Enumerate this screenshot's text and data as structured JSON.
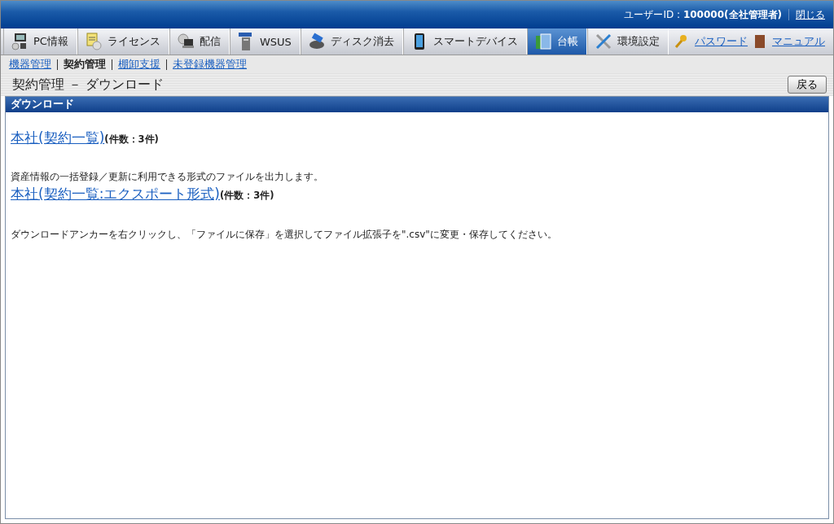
{
  "header": {
    "user": "ユーザーID : **100000(全社管理者)**",
    "close": "閉じる"
  },
  "tabs": [
    {
      "label": "PC情報",
      "selected": false
    },
    {
      "label": "ライセンス",
      "selected": false
    },
    {
      "label": "配信",
      "selected": false
    },
    {
      "label": "WSUS",
      "selected": false
    },
    {
      "label": "ディスク消去",
      "selected": false
    },
    {
      "label": "スマートデバイス",
      "selected": false
    },
    {
      "label": "台帳",
      "selected": true
    },
    {
      "label": "環境設定",
      "selected": false
    }
  ],
  "tools": [
    {
      "label": "パスワード"
    },
    {
      "label": "マニュアル"
    }
  ],
  "subnav": [
    {
      "label": "機器管理",
      "selected": false
    },
    {
      "label": "契約管理",
      "selected": true
    },
    {
      "label": "棚卸支援",
      "selected": false
    },
    {
      "label": "未登録機器管理",
      "selected": false
    }
  ],
  "page_title": "契約管理 － ダウンロード",
  "back_button": "戻る",
  "section": {
    "title": "ダウンロード",
    "items": [
      {
        "link": "本社(契約一覧)",
        "count": "(件数：3件)"
      },
      {
        "description": "資産情報の一括登録／更新に利用できる形式のファイルを出力します。",
        "link": "本社(契約一覧:エクスポート形式)",
        "count": "(件数：3件)"
      }
    ],
    "note": "ダウンロードアンカーを右クリックし、「ファイルに保存」を選択してファイル拡張子を\".csv\"に変更・保存してください。"
  }
}
